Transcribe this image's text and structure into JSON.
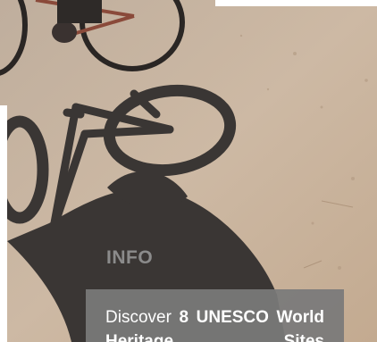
{
  "info": {
    "label": "INFO"
  },
  "promo": {
    "lead": "Discover",
    "highlight": "8 UNESCO",
    "rest": "World Heritage Sites"
  },
  "colors": {
    "road": "#c9b7a3",
    "shadow": "#3a3634",
    "label_gray": "#8b8b8b",
    "box_gray": "#7a7a7a"
  }
}
